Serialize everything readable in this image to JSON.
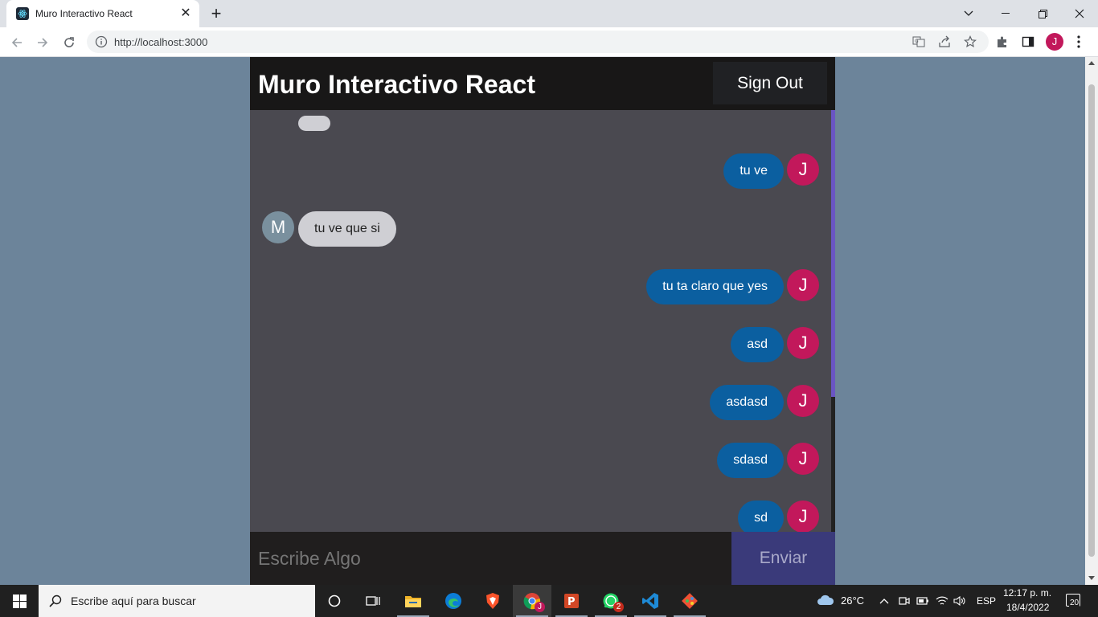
{
  "browser": {
    "tab_title": "Muro Interactivo React",
    "url": "http://localhost:3000",
    "profile_initial": "J"
  },
  "app": {
    "title": "Muro Interactivo React",
    "signout_label": "Sign Out",
    "messages": [
      {
        "text": "tu ve",
        "avatar": "J",
        "type": "sent"
      },
      {
        "text": "tu ve que si",
        "avatar": "M",
        "type": "received"
      },
      {
        "text": "tu ta claro que yes",
        "avatar": "J",
        "type": "sent"
      },
      {
        "text": "asd",
        "avatar": "J",
        "type": "sent"
      },
      {
        "text": "asdasd",
        "avatar": "J",
        "type": "sent"
      },
      {
        "text": "sdasd",
        "avatar": "J",
        "type": "sent"
      },
      {
        "text": "sd",
        "avatar": "J",
        "type": "sent"
      }
    ],
    "composer": {
      "placeholder": "Escribe Algo",
      "send_label": "Enviar"
    },
    "colors": {
      "sent_bubble": "#0b5fa0",
      "received_bubble": "#cfcfd4",
      "sent_avatar": "#c2185b",
      "received_avatar": "#7a909e",
      "send_button": "#3a3a7a"
    }
  },
  "taskbar": {
    "search_placeholder": "Escribe aquí para buscar",
    "weather": "26°C",
    "language": "ESP",
    "time": "12:17 p. m.",
    "date": "18/4/2022",
    "notification_count": "20",
    "whatsapp_badge": "2",
    "apps": [
      "task-view",
      "file-explorer",
      "edge",
      "brave",
      "chrome",
      "powerpoint",
      "whatsapp",
      "vscode",
      "git"
    ]
  }
}
